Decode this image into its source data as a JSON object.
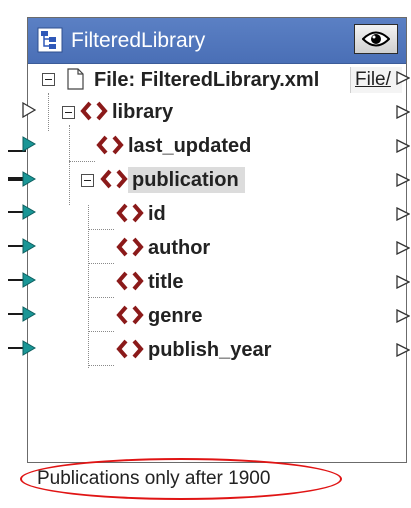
{
  "component": {
    "title": "FilteredLibrary",
    "file_row_label": "File: FilteredLibrary.xml",
    "file_button_label": "File/"
  },
  "tree": {
    "items": [
      {
        "label": "library"
      },
      {
        "label": "last_updated"
      },
      {
        "label": "publication"
      },
      {
        "label": "id"
      },
      {
        "label": "author"
      },
      {
        "label": "title"
      },
      {
        "label": "genre"
      },
      {
        "label": "publish_year"
      }
    ]
  },
  "note": {
    "text": "Publications only after 1900"
  },
  "colors": {
    "titlebar": "#4a6fb6",
    "tag_icon": "#8b1a1a",
    "connector_fill": "#1a9696",
    "annotation_ring": "#e01414"
  },
  "icons": {
    "title": "component-tree-icon",
    "eye": "eye-icon",
    "file": "file-icon",
    "element": "xml-element-icon"
  }
}
